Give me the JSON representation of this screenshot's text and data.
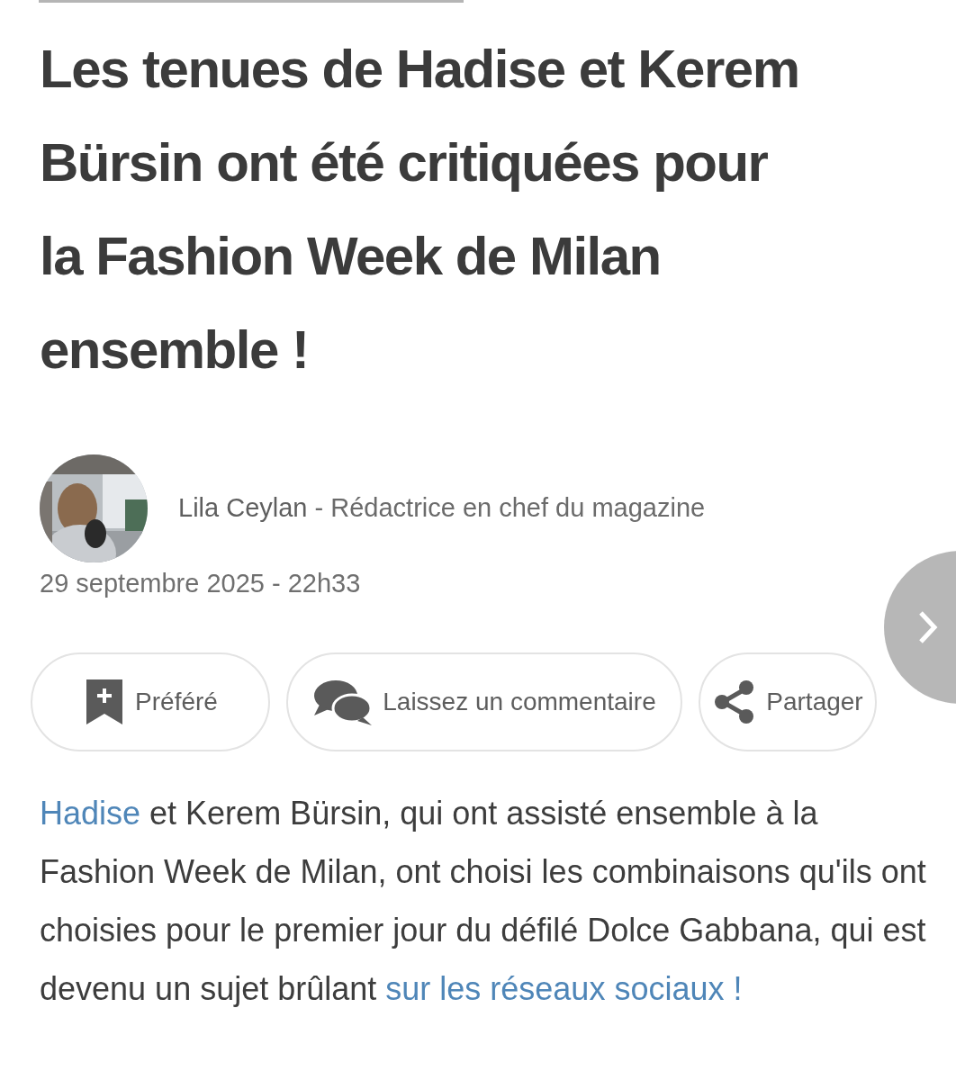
{
  "article": {
    "title": "Les tenues de Hadise et Kerem Bürsin ont été critiquées pour la Fashion Week de Milan ensemble !",
    "author": {
      "name": "Lila Ceylan",
      "separator": "-",
      "role": "Rédactrice en chef du magazine"
    },
    "date": "29 septembre 2025 - 22h33",
    "actions": [
      {
        "kind": "bookmark",
        "label": "Préféré"
      },
      {
        "kind": "comment",
        "label": "Laissez un commentaire"
      },
      {
        "kind": "share",
        "label": "Partager"
      }
    ],
    "body": [
      {
        "text": "Hadise",
        "link": true
      },
      {
        "text": " et Kerem Bürsin, qui ont assisté ensemble à la Fashion Week de Milan, ont choisi les combinaisons qu'ils ont choisies pour le premier jour du défilé Dolce Gabbana, qui est devenu un sujet brûlant ",
        "link": false
      },
      {
        "text": "sur les réseaux sociaux !",
        "link": true
      }
    ]
  }
}
